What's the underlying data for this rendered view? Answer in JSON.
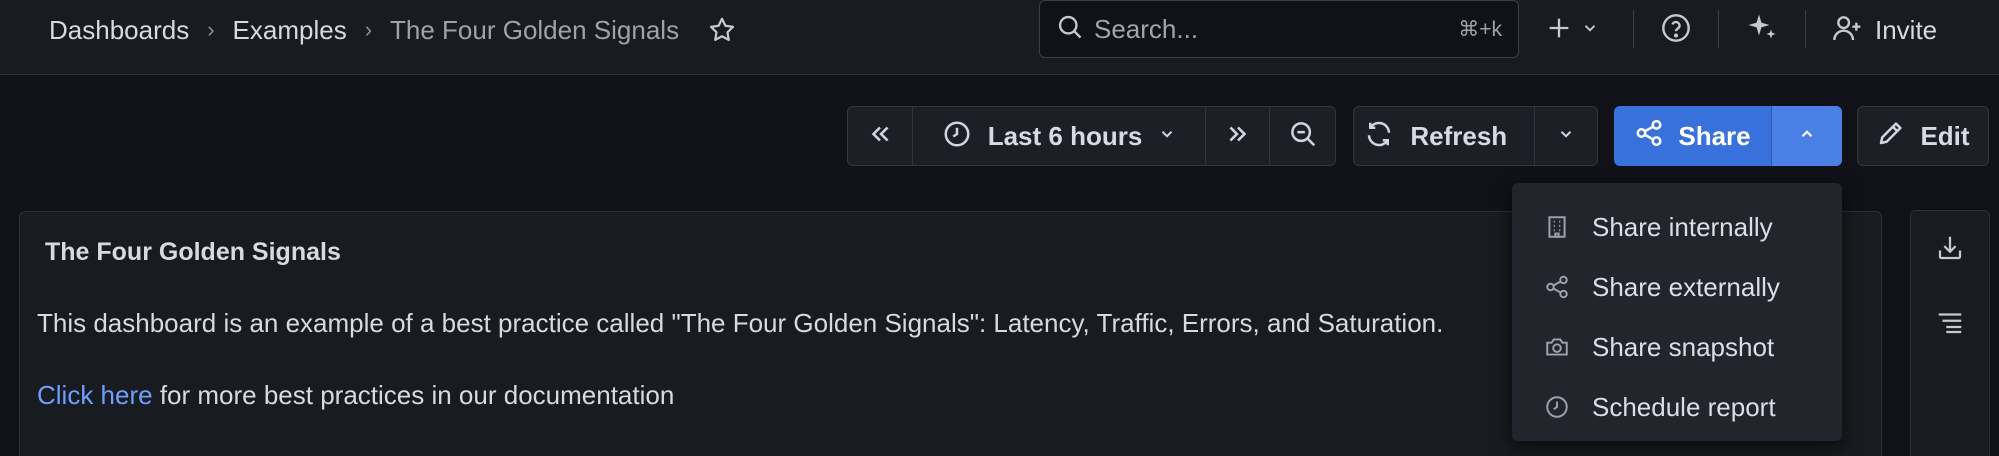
{
  "breadcrumb": {
    "items": [
      "Dashboards",
      "Examples",
      "The Four Golden Signals"
    ]
  },
  "search": {
    "placeholder": "Search...",
    "shortcut": "⌘+k"
  },
  "topbar": {
    "invite_label": "Invite"
  },
  "timepicker": {
    "range_label": "Last 6 hours"
  },
  "refresh": {
    "label": "Refresh"
  },
  "share": {
    "label": "Share"
  },
  "edit": {
    "label": "Edit"
  },
  "share_menu": {
    "items": [
      {
        "label": "Share internally",
        "icon": "building-icon"
      },
      {
        "label": "Share externally",
        "icon": "share-nodes-icon"
      },
      {
        "label": "Share snapshot",
        "icon": "camera-icon"
      },
      {
        "label": "Schedule report",
        "icon": "clock-icon"
      }
    ]
  },
  "panel": {
    "title": "The Four Golden Signals",
    "description": "This dashboard is an example of a best practice called \"The Four Golden Signals\": Latency, Traffic, Errors, and Saturation.",
    "link_text": "Click here",
    "link_suffix": " for more best practices in our documentation"
  },
  "colors": {
    "background": "#111217",
    "primary": "#3871dc",
    "link": "#6e9fff",
    "menu": "#22252b"
  }
}
